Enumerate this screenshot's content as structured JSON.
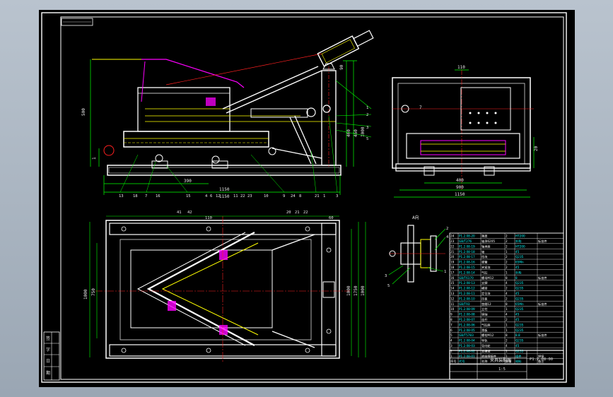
{
  "colors": {
    "background": "#000000",
    "frame": "#ffffff",
    "part": "#ffffff",
    "dimension": "#00ff00",
    "centerline": "#ff2020",
    "hidden": "#ffff00",
    "highlight": "#ff00ff",
    "annotation": "#00ffff"
  },
  "front_view": {
    "left_dims": [
      "500",
      "1"
    ],
    "right_dims": [
      "90",
      "460",
      "460",
      "1000"
    ],
    "bottom_dims": [
      "390",
      "1150",
      "1150"
    ],
    "balloons": [
      "13",
      "18",
      "7",
      "16",
      "15",
      "4",
      "6",
      "12",
      "11",
      "22",
      "23",
      "10",
      "9",
      "24",
      "8",
      "21",
      "1",
      "3"
    ],
    "right_balloons": [
      "1",
      "2",
      "3",
      "5"
    ]
  },
  "side_view": {
    "top_dims": [
      "110",
      "7"
    ],
    "right_dims": [
      "20",
      "16"
    ],
    "bottom_dims": [
      "400",
      "900",
      "1150"
    ]
  },
  "plan_view": {
    "top_dims": [
      "41",
      "42",
      "110",
      "20",
      "21",
      "22",
      "60"
    ],
    "left_dims": [
      "1000",
      "750"
    ],
    "right_dims": [
      "1000",
      "1750",
      "1000"
    ]
  },
  "detail_view": {
    "title": "A向",
    "balloons": [
      "2",
      "4",
      "3",
      "1",
      "5"
    ]
  },
  "parts_table": {
    "rows": [
      {
        "no": "1",
        "code": "P1.2.08-01",
        "name": "底座焊接件",
        "qty": "1",
        "material": "组件",
        "remark": "焊接"
      },
      {
        "no": "2",
        "code": "P1.2.08-02",
        "name": "支撑架",
        "qty": "1",
        "material": "Q235",
        "remark": ""
      },
      {
        "no": "3",
        "code": "P1.2.08-03",
        "name": "导向轮",
        "qty": "4",
        "material": "45",
        "remark": ""
      },
      {
        "no": "4",
        "code": "P1.2.08-04",
        "name": "导轨",
        "qty": "2",
        "material": "Q235",
        "remark": ""
      },
      {
        "no": "5",
        "code": "GB/T5783",
        "name": "螺栓M12",
        "qty": "8",
        "material": "8.8",
        "remark": "标准件"
      },
      {
        "no": "6",
        "code": "P1.2.08-05",
        "name": "滑板",
        "qty": "1",
        "material": "Q235",
        "remark": ""
      },
      {
        "no": "7",
        "code": "P1.2.08-06",
        "name": "气缸座",
        "qty": "1",
        "material": "Q235",
        "remark": ""
      },
      {
        "no": "8",
        "code": "P1.2.08-07",
        "name": "连杆",
        "qty": "2",
        "material": "45",
        "remark": ""
      },
      {
        "no": "9",
        "code": "P1.2.08-08",
        "name": "销轴",
        "qty": "4",
        "material": "45",
        "remark": ""
      },
      {
        "no": "10",
        "code": "P1.2.08-09",
        "name": "立柱",
        "qty": "1",
        "material": "Q235",
        "remark": ""
      },
      {
        "no": "11",
        "code": "GB/T93",
        "name": "垫圈12",
        "qty": "8",
        "material": "65Mn",
        "remark": "标准件"
      },
      {
        "no": "12",
        "code": "P1.2.08-10",
        "name": "压板",
        "qty": "2",
        "material": "Q235",
        "remark": ""
      },
      {
        "no": "13",
        "code": "P1.2.08-11",
        "name": "定位块",
        "qty": "4",
        "material": "45",
        "remark": ""
      },
      {
        "no": "14",
        "code": "P1.2.08-12",
        "name": "横梁",
        "qty": "2",
        "material": "Q235",
        "remark": ""
      },
      {
        "no": "15",
        "code": "P1.2.08-13",
        "name": "支脚",
        "qty": "4",
        "material": "Q235",
        "remark": ""
      },
      {
        "no": "16",
        "code": "GB/T6170",
        "name": "螺母M12",
        "qty": "8",
        "material": "8",
        "remark": "标准件"
      },
      {
        "no": "17",
        "code": "P1.2.08-14",
        "name": "气缸",
        "qty": "1",
        "material": "外购",
        "remark": ""
      },
      {
        "no": "18",
        "code": "P1.2.08-15",
        "name": "夹紧块",
        "qty": "2",
        "material": "45",
        "remark": ""
      },
      {
        "no": "19",
        "code": "P1.2.08-16",
        "name": "弹簧",
        "qty": "2",
        "material": "65Mn",
        "remark": ""
      },
      {
        "no": "20",
        "code": "P1.2.08-17",
        "name": "挡块",
        "qty": "2",
        "material": "Q235",
        "remark": ""
      },
      {
        "no": "21",
        "code": "P1.2.08-18",
        "name": "轴",
        "qty": "1",
        "material": "45",
        "remark": ""
      },
      {
        "no": "22",
        "code": "P1.2.08-19",
        "name": "轴承座",
        "qty": "2",
        "material": "HT200",
        "remark": ""
      },
      {
        "no": "23",
        "code": "GB/T276",
        "name": "轴承6205",
        "qty": "2",
        "material": "外购",
        "remark": "标准件"
      },
      {
        "no": "24",
        "code": "P1.2.08-20",
        "name": "端盖",
        "qty": "2",
        "material": "HT200",
        "remark": ""
      }
    ],
    "header": {
      "no": "序号",
      "code": "代号",
      "name": "名称",
      "qty": "数量",
      "material": "材料",
      "remark": "备注"
    }
  },
  "title_block": {
    "name": "夹具装配图",
    "drawing_no": "P1.2.08-00",
    "scale": "1:5"
  },
  "left_block": [
    "签",
    "字",
    "日",
    "期"
  ]
}
